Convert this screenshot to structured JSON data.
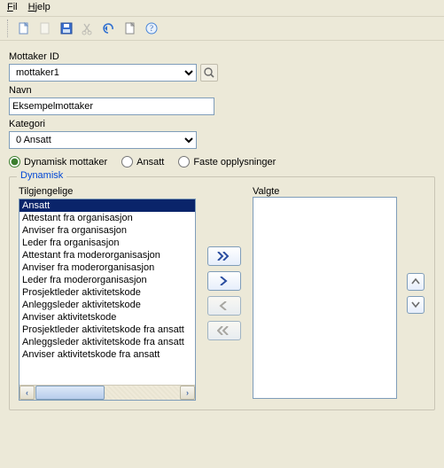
{
  "menu": {
    "file": "Fil",
    "help": "Hjelp"
  },
  "toolbar": {
    "new": "new",
    "open": "open",
    "save": "save",
    "cut": "cut",
    "undo": "undo",
    "page": "page",
    "help": "help"
  },
  "labels": {
    "mottaker_id": "Mottaker ID",
    "navn": "Navn",
    "kategori": "Kategori"
  },
  "fields": {
    "mottaker_id": "mottaker1",
    "navn": "Eksempelmottaker",
    "kategori": "0 Ansatt"
  },
  "radios": {
    "dynamisk": "Dynamisk mottaker",
    "ansatt": "Ansatt",
    "faste": "Faste opplysninger",
    "selected": "dynamisk"
  },
  "fieldset": {
    "legend": "Dynamisk",
    "available_label": "Tilgjengelige",
    "chosen_label": "Valgte"
  },
  "available": [
    "Ansatt",
    "Attestant fra organisasjon",
    "Anviser fra organisasjon",
    "Leder fra organisasjon",
    "Attestant fra moderorganisasjon",
    "Anviser fra moderorganisasjon",
    "Leder fra moderorganisasjon",
    "Prosjektleder aktivitetskode",
    "Anleggsleder aktivitetskode",
    "Anviser aktivitetskode",
    "Prosjektleder aktivitetskode fra ansatt",
    "Anleggsleder aktivitetskode fra ansatt",
    "Anviser aktivitetskode fra ansatt"
  ],
  "selected_index": 0,
  "chosen": [],
  "icons": {
    "search": "⌕",
    "move_all_right": "»",
    "move_right": "›",
    "move_left": "‹",
    "move_all_left": "«",
    "up": "▲",
    "down": "▼",
    "scroll_left": "‹",
    "scroll_right": "›"
  }
}
